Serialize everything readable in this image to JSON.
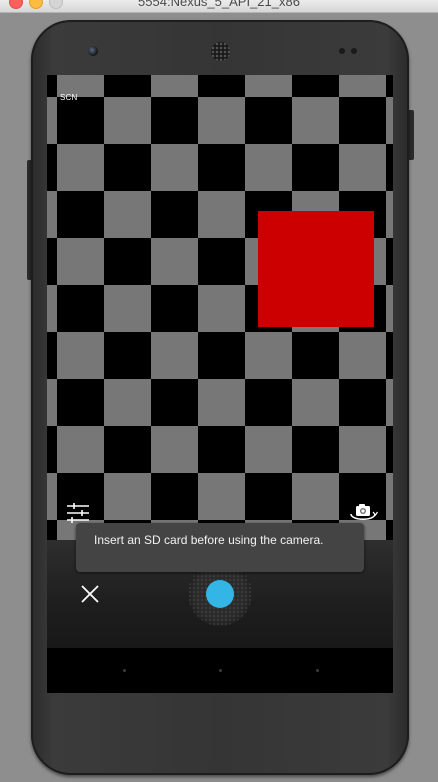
{
  "window": {
    "title": "5554:Nexus_5_API_21_x86"
  },
  "camera": {
    "scene_mode_label": "SCN",
    "toast_message": "Insert an SD card before using the camera.",
    "viewfinder": {
      "pattern": "checkerboard",
      "colors": [
        "#000000",
        "#777777"
      ],
      "object_color": "#cc0000"
    },
    "accent_color": "#33b5e5",
    "icons": {
      "settings": "sliders-icon",
      "switch_camera": "switch-camera-icon",
      "cancel": "close-icon",
      "shutter": "shutter-icon"
    }
  }
}
